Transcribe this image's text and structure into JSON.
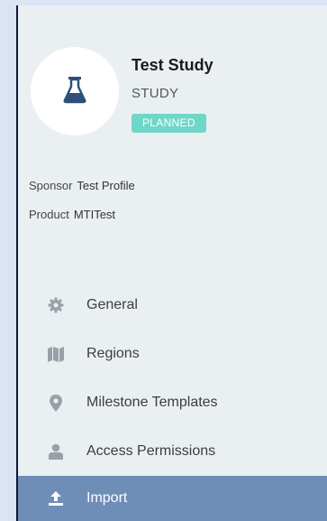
{
  "study": {
    "name": "Test Study",
    "type": "STUDY",
    "status": "PLANNED",
    "avatar_icon": "flask-icon",
    "sponsor_label": "Sponsor",
    "sponsor_value": "Test Profile",
    "product_label": "Product",
    "product_value": "MTITest"
  },
  "nav": {
    "items": [
      {
        "label": "General",
        "icon": "gear-icon"
      },
      {
        "label": "Regions",
        "icon": "map-icon"
      },
      {
        "label": "Milestone Templates",
        "icon": "map-pin-icon"
      },
      {
        "label": "Access Permissions",
        "icon": "user-icon"
      },
      {
        "label": "Import",
        "icon": "upload-icon",
        "active": true
      }
    ]
  },
  "colors": {
    "outer_background": "#dbe4f3",
    "panel_background": "#eaf0f2",
    "accent_dark_blue": "#2f4f7a",
    "status_badge": "#6ed7c8",
    "active_item": "#6e8eb7"
  }
}
